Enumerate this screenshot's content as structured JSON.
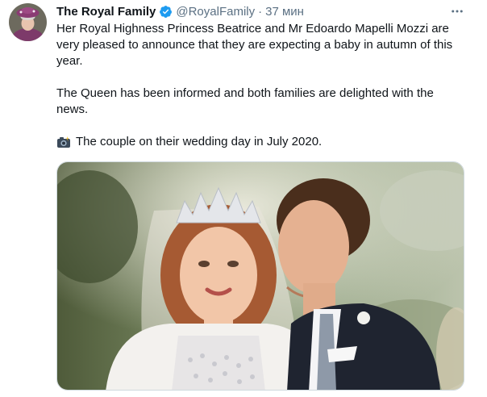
{
  "author": {
    "display_name": "The Royal Family",
    "handle": "@RoyalFamily",
    "separator": "·",
    "time": "37 мин",
    "avatar_icon": "avatar-photo",
    "verified_icon": "verified-badge-icon",
    "verified_color": "#1d9bf0"
  },
  "tweet": {
    "paragraphs": [
      "Her Royal Highness Princess Beatrice and Mr Edoardo Mapelli Mozzi are very pleased to announce that they are expecting a baby in autumn of this year.",
      "The Queen has been informed and both families are delighted with the news."
    ],
    "caption_emoji_icon": "camera-flash-icon",
    "caption": "The couple on their wedding day in July 2020."
  },
  "menu": {
    "more_icon": "more-horizontal-icon"
  },
  "colors": {
    "text": "#0f1419",
    "secondary": "#5b7083",
    "border": "#cfd9de"
  }
}
